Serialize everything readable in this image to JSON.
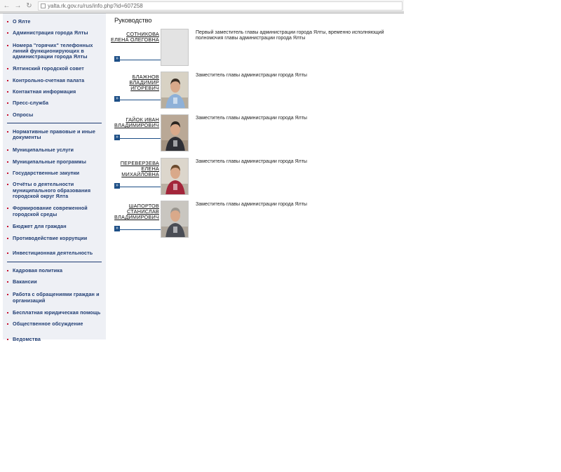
{
  "browser": {
    "back_icon": "arrow-left-icon",
    "forward_icon": "arrow-right-icon",
    "reload_icon": "reload-icon",
    "url": "yalta.rk.gov.ru/rus/info.php?id=607258"
  },
  "sidebar": {
    "groups": [
      [
        "О Ялте",
        "Администрация города Ялты",
        "Номера \"горячих\" телефонных линий функционирующих в администрации города Ялты",
        "Ялтинский городской совет",
        "Контрольно-счетная палата",
        "Контактная информация",
        "Пресс-служба",
        "Опросы"
      ],
      [
        "Нормативные правовые и иные документы",
        "Муниципальные услуги",
        "Муниципальные программы",
        "Государственные закупки",
        "Отчёты о деятельности муниципального образования городской округ Ялта",
        "Формирование современной городской среды",
        "Бюджет для граждан",
        "Противодействие коррупции",
        "Инвестиционная деятельность"
      ],
      [
        "Кадровая политика",
        "Вакансии",
        "Работа с обращениями граждан и организаций",
        "Бесплатная юридическая помощь",
        "Общественное обсуждение",
        "Ведомства"
      ]
    ]
  },
  "main": {
    "heading": "Руководство",
    "people": [
      {
        "name": "СОТНИКОВА ЕЛЕНА ОЛЕГОВНА",
        "role": "Первый заместитель главы администрации города Ялты, временно исполняющий полномочия главы администрации города Ялты",
        "photo": "no-photo"
      },
      {
        "name": "БЛАЖНОВ ВЛАДИМИР ИГОРЕВИЧ",
        "role": "Заместитель главы администрации города Ялты",
        "photo": "man-light-shirt"
      },
      {
        "name": "ГАЙОК ИВАН ВЛАДИМИРОВИЧ",
        "role": "Заместитель главы администрации города Ялты",
        "photo": "man-dark-suit"
      },
      {
        "name": "ПЕРЕВЕРЗЕВА ЕЛЕНА МИХАЙЛОВНА",
        "role": "Заместитель главы администрации города Ялты",
        "photo": "woman-red-top"
      },
      {
        "name": "ШАПОРТОВ СТАНИСЛАВ ВЛАДИМИРОВИЧ",
        "role": "Заместитель главы администрации города Ялты",
        "photo": "man-grey-suit"
      }
    ]
  },
  "colors": {
    "link": "#1f3c72",
    "bullet": "#c8102e",
    "arrow": "#1c4e86",
    "sidebar_bg": "#eef0f5"
  }
}
